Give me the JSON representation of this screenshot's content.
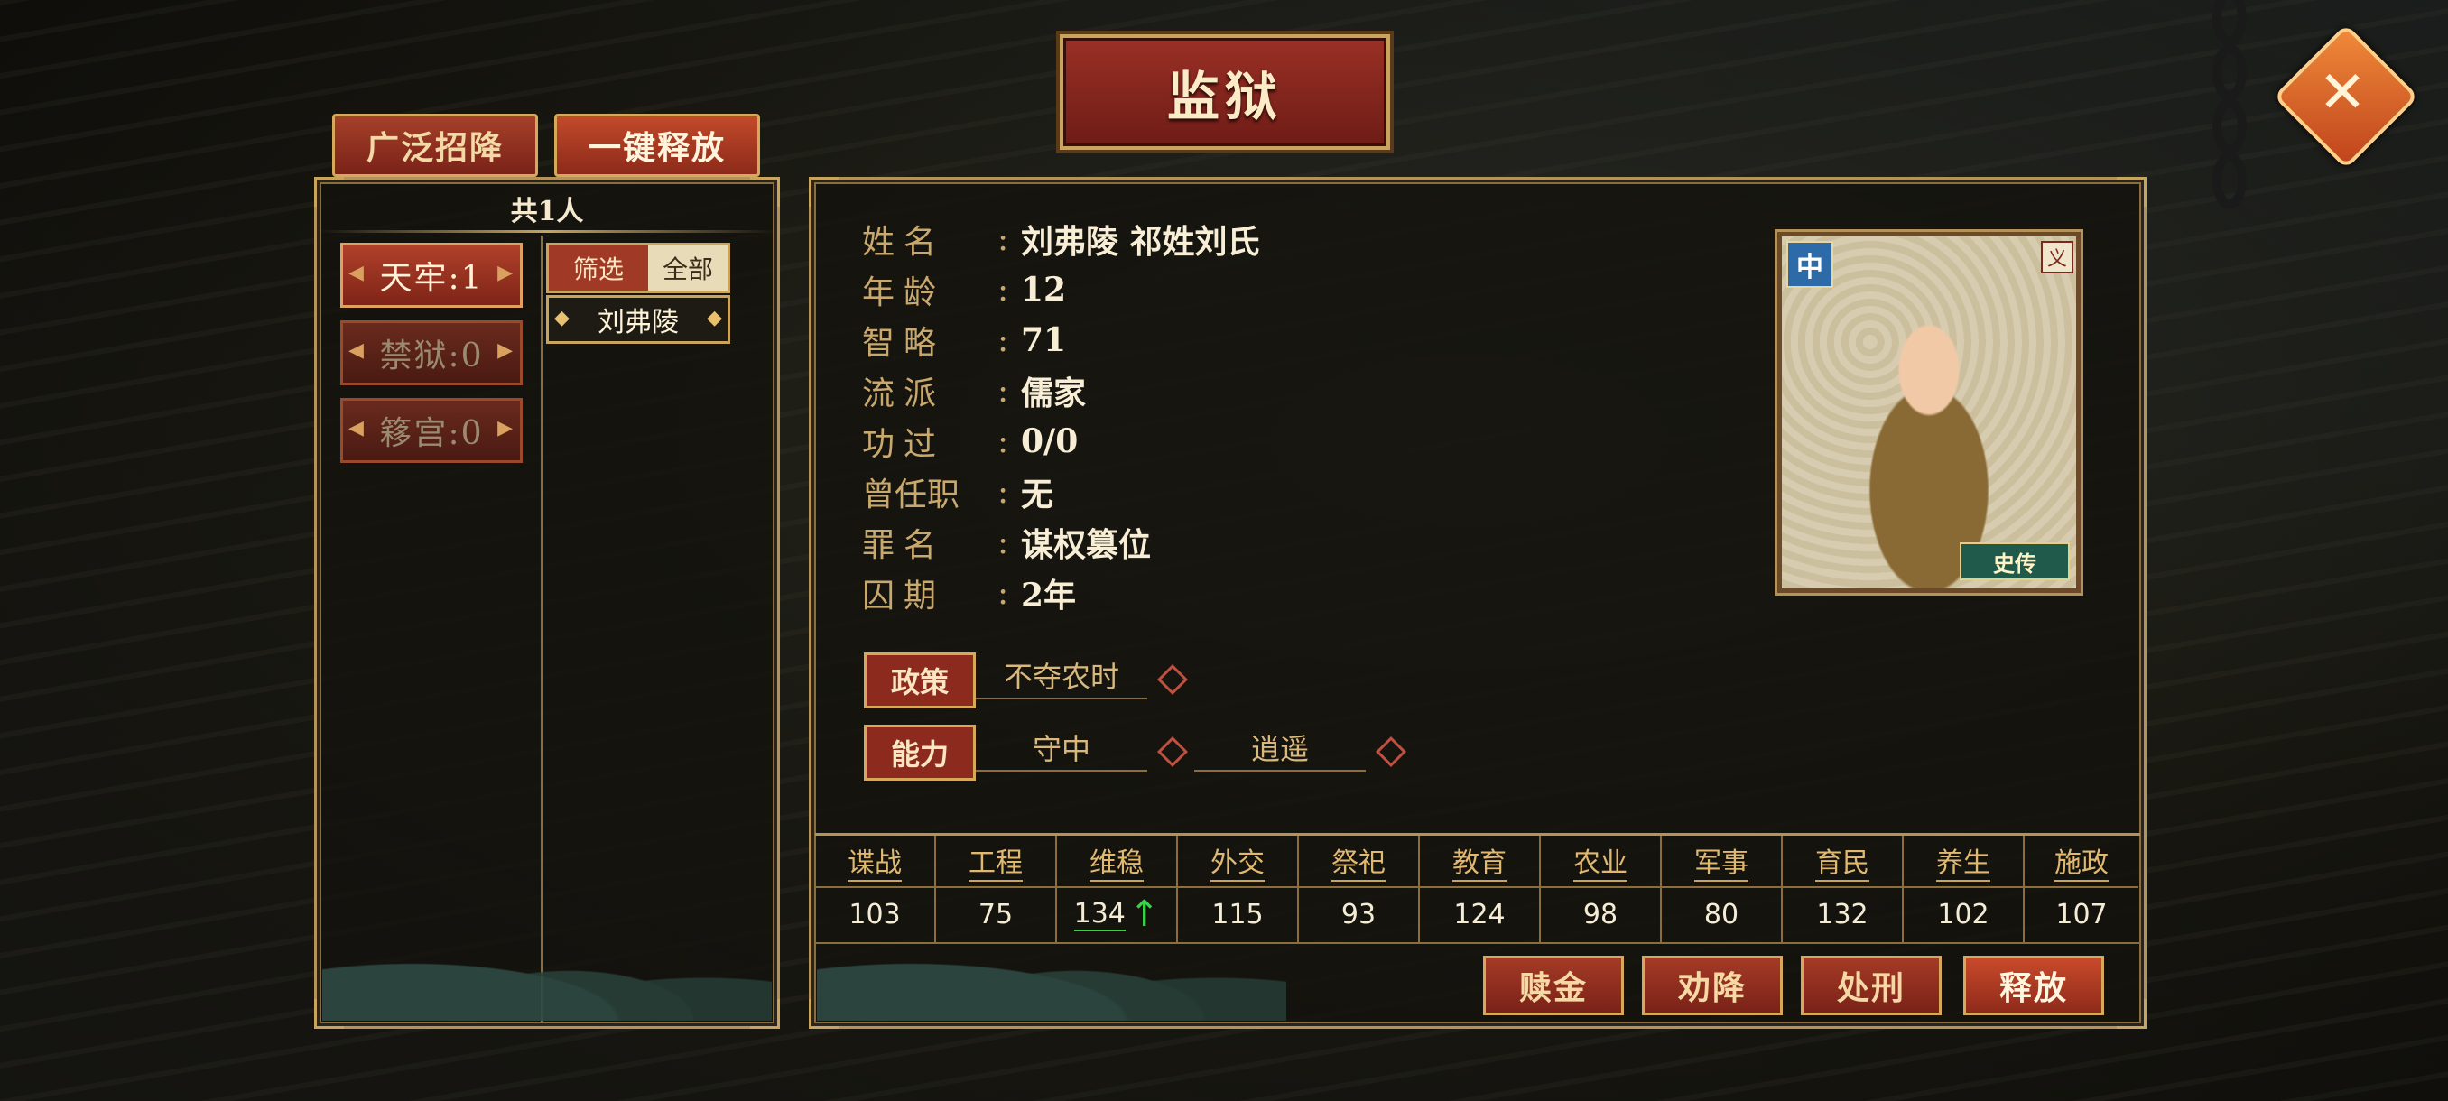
{
  "window": {
    "title": "监狱",
    "close_icon": "close-icon"
  },
  "top_buttons": {
    "recruit": "广泛招降",
    "release_all": "一键释放"
  },
  "list": {
    "total": "共1人",
    "categories": [
      {
        "label": "天牢:1",
        "active": true
      },
      {
        "label": "禁狱:0",
        "active": false
      },
      {
        "label": "簃宫:0",
        "active": false
      }
    ],
    "filter_label": "筛选",
    "filter_value": "全部",
    "prisoners": [
      "刘弗陵"
    ]
  },
  "detail": {
    "fields": [
      {
        "key": "姓名",
        "value": "刘弗陵  祁姓刘氏"
      },
      {
        "key": "年龄",
        "value": "12"
      },
      {
        "key": "智略",
        "value": "71"
      },
      {
        "key": "流派",
        "value": "儒家"
      },
      {
        "key": "功过",
        "value": "0/0"
      },
      {
        "key": "曾任职",
        "value": "无"
      },
      {
        "key": "罪名",
        "value": "谋权篡位"
      },
      {
        "key": "囚期",
        "value": "2年"
      }
    ],
    "portrait": {
      "rank": "中",
      "trait": "义",
      "badge": "史传"
    },
    "policy_label": "政策",
    "policies": [
      "不夺农时"
    ],
    "ability_label": "能力",
    "abilities": [
      "守中",
      "逍遥"
    ]
  },
  "stats": {
    "headers": [
      "谍战",
      "工程",
      "维稳",
      "外交",
      "祭祀",
      "教育",
      "农业",
      "军事",
      "育民",
      "养生",
      "施政"
    ],
    "values": [
      "103",
      "75",
      "134",
      "115",
      "93",
      "124",
      "98",
      "80",
      "132",
      "102",
      "107"
    ],
    "up_arrow": "↑"
  },
  "actions": {
    "ransom": "赎金",
    "persuade": "劝降",
    "execute": "处刑",
    "release": "释放"
  }
}
